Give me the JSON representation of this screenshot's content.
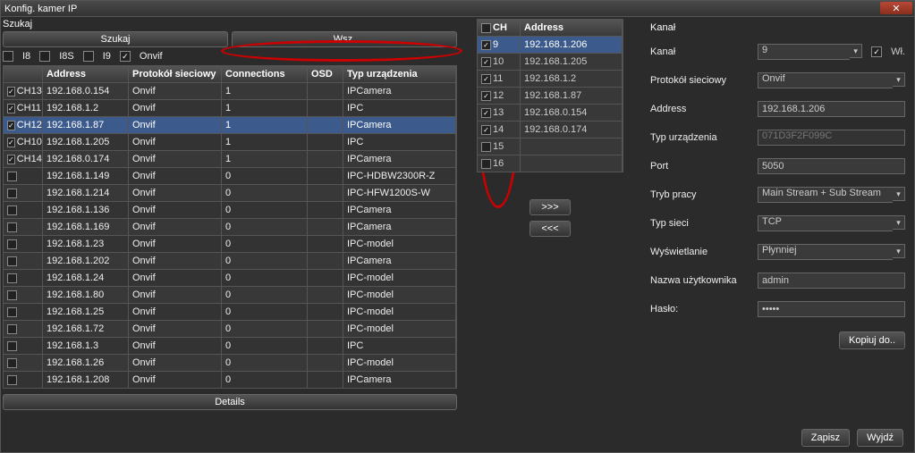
{
  "title": "Konfig. kamer IP",
  "left": {
    "search_label": "Szukaj",
    "search_btn": "Szukaj",
    "all_btn": "Wsz.",
    "filters": {
      "i8": "I8",
      "i8s": "I8S",
      "i9": "I9",
      "onvif": "Onvif"
    },
    "headers": {
      "address": "Address",
      "protocol": "Protokół sieciowy",
      "connections": "Connections",
      "osd": "OSD",
      "type": "Typ urządzenia"
    },
    "rows": [
      {
        "checked": true,
        "ch": "CH13",
        "addr": "192.168.0.154",
        "proto": "Onvif",
        "conn": "1",
        "type": "IPCamera"
      },
      {
        "checked": true,
        "ch": "CH11",
        "addr": "192.168.1.2",
        "proto": "Onvif",
        "conn": "1",
        "type": "IPC"
      },
      {
        "checked": true,
        "ch": "CH12",
        "addr": "192.168.1.87",
        "proto": "Onvif",
        "conn": "1",
        "type": "IPCamera",
        "selected": true
      },
      {
        "checked": true,
        "ch": "CH10",
        "addr": "192.168.1.205",
        "proto": "Onvif",
        "conn": "1",
        "type": "IPC"
      },
      {
        "checked": true,
        "ch": "CH14",
        "addr": "192.168.0.174",
        "proto": "Onvif",
        "conn": "1",
        "type": "IPCamera"
      },
      {
        "checked": false,
        "ch": "",
        "addr": "192.168.1.149",
        "proto": "Onvif",
        "conn": "0",
        "type": "IPC-HDBW2300R-Z"
      },
      {
        "checked": false,
        "ch": "",
        "addr": "192.168.1.214",
        "proto": "Onvif",
        "conn": "0",
        "type": "IPC-HFW1200S-W"
      },
      {
        "checked": false,
        "ch": "",
        "addr": "192.168.1.136",
        "proto": "Onvif",
        "conn": "0",
        "type": "IPCamera"
      },
      {
        "checked": false,
        "ch": "",
        "addr": "192.168.1.169",
        "proto": "Onvif",
        "conn": "0",
        "type": "IPCamera"
      },
      {
        "checked": false,
        "ch": "",
        "addr": "192.168.1.23",
        "proto": "Onvif",
        "conn": "0",
        "type": "IPC-model"
      },
      {
        "checked": false,
        "ch": "",
        "addr": "192.168.1.202",
        "proto": "Onvif",
        "conn": "0",
        "type": "IPCamera"
      },
      {
        "checked": false,
        "ch": "",
        "addr": "192.168.1.24",
        "proto": "Onvif",
        "conn": "0",
        "type": "IPC-model"
      },
      {
        "checked": false,
        "ch": "",
        "addr": "192.168.1.80",
        "proto": "Onvif",
        "conn": "0",
        "type": "IPC-model"
      },
      {
        "checked": false,
        "ch": "",
        "addr": "192.168.1.25",
        "proto": "Onvif",
        "conn": "0",
        "type": "IPC-model"
      },
      {
        "checked": false,
        "ch": "",
        "addr": "192.168.1.72",
        "proto": "Onvif",
        "conn": "0",
        "type": "IPC-model"
      },
      {
        "checked": false,
        "ch": "",
        "addr": "192.168.1.3",
        "proto": "Onvif",
        "conn": "0",
        "type": "IPC"
      },
      {
        "checked": false,
        "ch": "",
        "addr": "192.168.1.26",
        "proto": "Onvif",
        "conn": "0",
        "type": "IPC-model"
      },
      {
        "checked": false,
        "ch": "",
        "addr": "192.168.1.208",
        "proto": "Onvif",
        "conn": "0",
        "type": "IPCamera"
      }
    ],
    "details_btn": "Details"
  },
  "mid": {
    "headers": {
      "ch": "CH",
      "address": "Address"
    },
    "rows": [
      {
        "checked": true,
        "ch": "9",
        "addr": "192.168.1.206",
        "selected": true
      },
      {
        "checked": true,
        "ch": "10",
        "addr": "192.168.1.205"
      },
      {
        "checked": true,
        "ch": "11",
        "addr": "192.168.1.2"
      },
      {
        "checked": true,
        "ch": "12",
        "addr": "192.168.1.87"
      },
      {
        "checked": true,
        "ch": "13",
        "addr": "192.168.0.154"
      },
      {
        "checked": true,
        "ch": "14",
        "addr": "192.168.0.174"
      },
      {
        "checked": false,
        "ch": "15",
        "addr": ""
      },
      {
        "checked": false,
        "ch": "16",
        "addr": ""
      }
    ],
    "add_btn": ">>>",
    "remove_btn": "<<<"
  },
  "right": {
    "section": "Kanał",
    "fields": {
      "kanal_label": "Kanał",
      "kanal_value": "9",
      "wl_label": "Wł.",
      "proto_label": "Protokół sieciowy",
      "proto_value": "Onvif",
      "address_label": "Address",
      "address_value": "192.168.1.206",
      "type_label": "Typ urządzenia",
      "type_value": "071D3F2F099C",
      "port_label": "Port",
      "port_value": "5050",
      "mode_label": "Tryb pracy",
      "mode_value": "Main Stream + Sub Stream",
      "net_label": "Typ sieci",
      "net_value": "TCP",
      "display_label": "Wyświetlanie",
      "display_value": "Płynniej",
      "user_label": "Nazwa użytkownika",
      "user_value": "admin",
      "pass_label": "Hasło:",
      "pass_value": "•••••"
    },
    "copy_btn": "Kopiuj do..",
    "save_btn": "Zapisz",
    "exit_btn": "Wyjdź"
  }
}
